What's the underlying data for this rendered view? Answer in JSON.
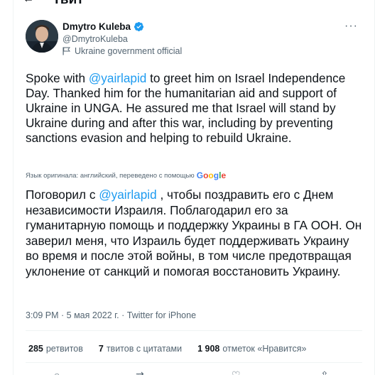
{
  "topbar": {
    "back_icon": "arrow-left-icon",
    "title": "Твит"
  },
  "author": {
    "name": "Dmytro Kuleba",
    "handle": "@DmytroKuleba",
    "label": "Ukraine government official",
    "verified_color": "#1d9bf0"
  },
  "tweet": {
    "en_segments": {
      "pre": "Spoke with ",
      "mention": "@yairlapid",
      "post": " to greet him on Israel Independence Day. Thanked him for the humanitarian aid and support of Ukraine in UNGA. He assured me that Israel will stand by Ukraine during and after this war, including by preventing sanctions evasion and helping to rebuild Ukraine."
    },
    "translation_note": "Язык оригинала: английский, переведено с помощью",
    "translation_provider": "Google",
    "ru_segments": {
      "pre": "Поговорил с ",
      "mention": "@yairlapid",
      "post": " , чтобы поздравить его с Днем независимости Израиля. Поблагодарил его за гуманитарную помощь и поддержку Украины в ГА ООН. Он заверил меня, что Израиль будет поддерживать Украину во время и после этой войны, в том числе предотвращая уклонение от санкций и помогая восстановить Украину."
    },
    "meta": "3:09 PM · 5 мая 2022 г. · Twitter for iPhone"
  },
  "stats": {
    "retweets_count": "285",
    "retweets_label": "ретвитов",
    "quotes_count": "7",
    "quotes_label": "твитов с цитатами",
    "likes_count": "1 908",
    "likes_label": "отметок «Нравится»"
  },
  "colors": {
    "accent": "#1d9bf0",
    "text": "#0f1419",
    "secondary": "#536471",
    "border": "#eff3f4"
  }
}
